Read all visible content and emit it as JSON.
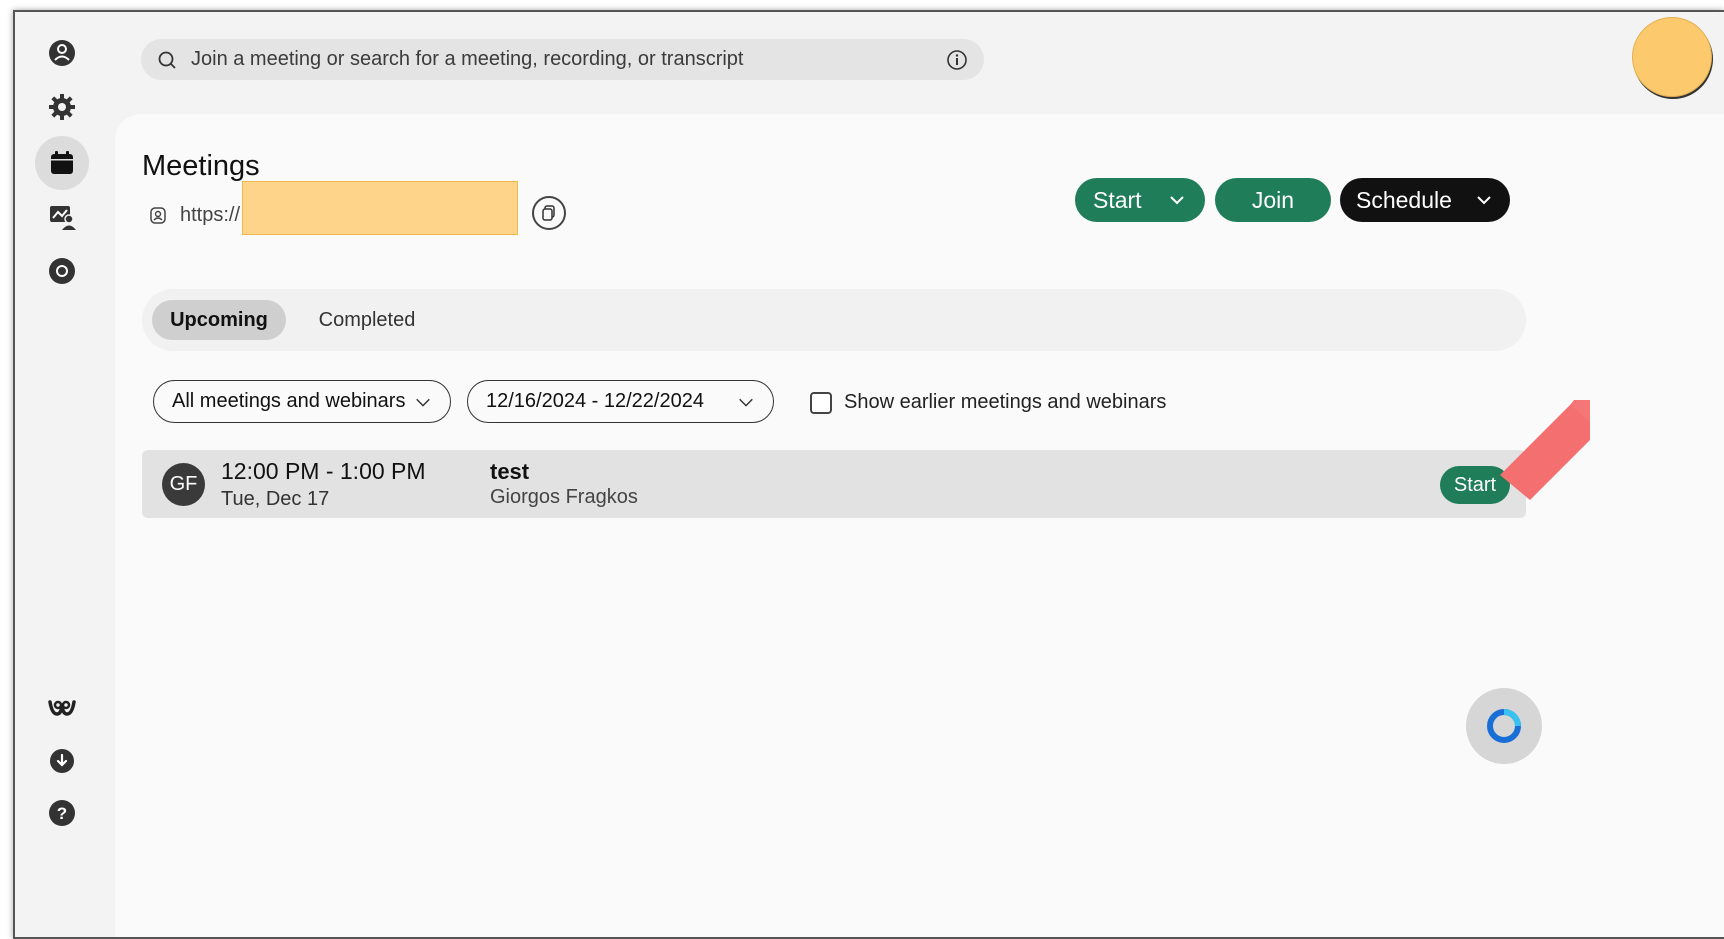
{
  "sidebar": {
    "items": [
      {
        "name": "contacts",
        "icon": "user-circle-icon"
      },
      {
        "name": "settings",
        "icon": "gear-icon"
      },
      {
        "name": "meetings",
        "icon": "calendar-icon",
        "active": true
      },
      {
        "name": "messaging",
        "icon": "chat-people-icon"
      },
      {
        "name": "recordings",
        "icon": "record-icon"
      }
    ],
    "bottom": [
      {
        "name": "webex",
        "icon": "webex-logo-icon"
      },
      {
        "name": "download",
        "icon": "download-icon"
      },
      {
        "name": "help",
        "icon": "help-icon"
      }
    ]
  },
  "search": {
    "placeholder": "Join a meeting or search for a meeting, recording, or transcript"
  },
  "header": {
    "title": "Meetings",
    "url_prefix": "https://"
  },
  "actions": {
    "start_label": "Start",
    "join_label": "Join",
    "schedule_label": "Schedule"
  },
  "tabs": [
    {
      "label": "Upcoming",
      "selected": true
    },
    {
      "label": "Completed",
      "selected": false
    }
  ],
  "filters": {
    "type_value": "All meetings and webinars",
    "date_range": "12/16/2024 - 12/22/2024",
    "show_earlier_label": "Show earlier meetings and webinars",
    "show_earlier_checked": false
  },
  "meetings": [
    {
      "initials": "GF",
      "time": "12:00 PM - 1:00 PM",
      "date": "Tue, Dec 17",
      "title": "test",
      "host": "Giorgos Fragkos",
      "action_label": "Start"
    }
  ],
  "colors": {
    "accent_green": "#1f7d59",
    "schedule_black": "#111111",
    "avatar_yellow": "#fdc96d",
    "annotation_arrow": "#f46f6f"
  }
}
